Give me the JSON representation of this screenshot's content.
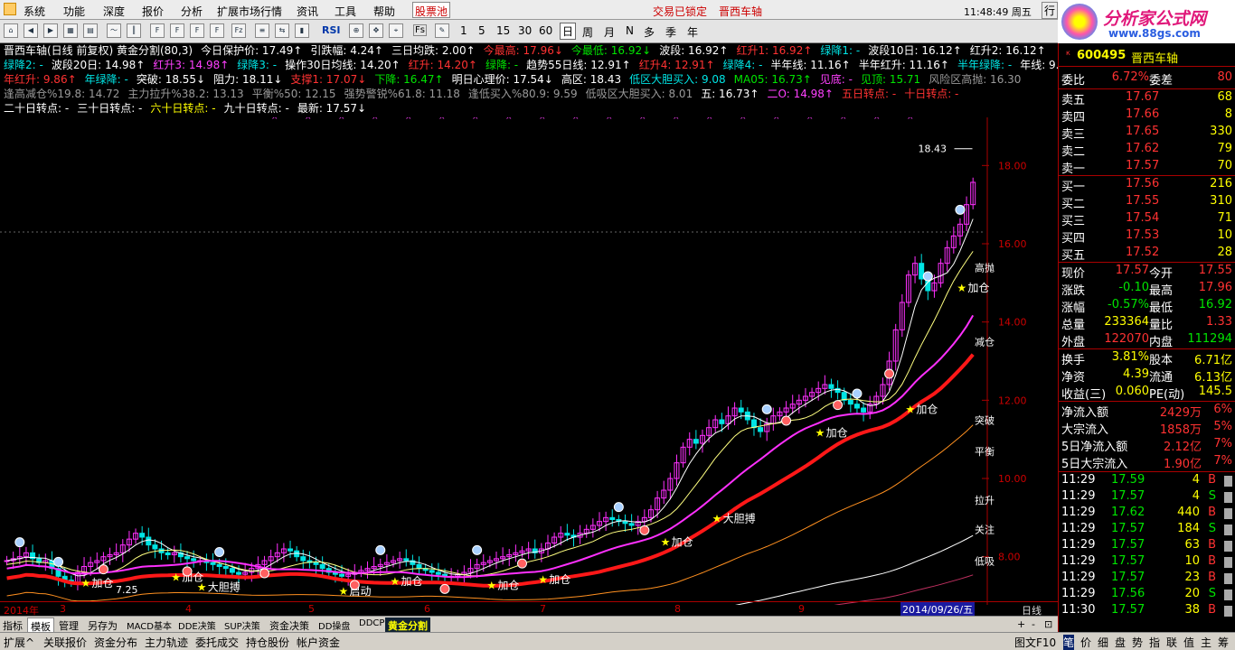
{
  "menu": {
    "items": [
      "系统",
      "功能",
      "深度",
      "报价",
      "分析",
      "扩展市场行情",
      "资讯",
      "工具",
      "帮助"
    ],
    "selected": "股票池",
    "status1": "交易已锁定",
    "stock_name": "晋西车轴",
    "clock": "11:48:49 周五",
    "right_stub": "行"
  },
  "logo": {
    "title": "分析家公式网",
    "url": "www.88gs.com"
  },
  "toolbar": {
    "periods": [
      "1",
      "5",
      "15",
      "30",
      "60",
      "日",
      "周",
      "月",
      "N",
      "多",
      "季",
      "年"
    ],
    "icon_labels": [
      "RSI",
      "Fs",
      "Fs"
    ]
  },
  "chart_info": {
    "line1": [
      {
        "t": "晋西车轴(日线 前复权) 黄金分割(80,3)",
        "c": "wht"
      },
      {
        "t": "今日保护价: 17.49↑",
        "c": "wht"
      },
      {
        "t": "引跌幅: 4.24↑",
        "c": "wht"
      },
      {
        "t": "三日均跌: 2.00↑",
        "c": "wht"
      },
      {
        "t": "今最高: 17.96↓",
        "c": "red"
      },
      {
        "t": "今最低: 16.92↓",
        "c": "grn"
      },
      {
        "t": "波段: 16.92↑",
        "c": "wht"
      },
      {
        "t": "红升1: 16.92↑",
        "c": "red"
      },
      {
        "t": "绿降1: -",
        "c": "cyan"
      },
      {
        "t": "波段10日: 16.12↑",
        "c": "wht"
      },
      {
        "t": "红升2: 16.12↑",
        "c": "wht"
      }
    ],
    "line2": [
      {
        "t": "绿降2: -",
        "c": "cyan"
      },
      {
        "t": "波段20日: 14.98↑",
        "c": "wht"
      },
      {
        "t": "红升3: 14.98↑",
        "c": "mag"
      },
      {
        "t": "绿降3: -",
        "c": "cyan"
      },
      {
        "t": "操作30日均线: 14.20↑",
        "c": "wht"
      },
      {
        "t": "红升: 14.20↑",
        "c": "red"
      },
      {
        "t": "绿降: -",
        "c": "grn"
      },
      {
        "t": "趋势55日线: 12.91↑",
        "c": "wht"
      },
      {
        "t": "红升4: 12.91↑",
        "c": "red"
      },
      {
        "t": "绿降4: -",
        "c": "cyan"
      },
      {
        "t": "半年线: 11.16↑",
        "c": "wht"
      },
      {
        "t": "半年红升: 11.16↑",
        "c": "wht"
      },
      {
        "t": "半年绿降: -",
        "c": "cyan"
      },
      {
        "t": "年线: 9.86",
        "c": "wht"
      }
    ],
    "line3": [
      {
        "t": "年红升: 9.86↑",
        "c": "red"
      },
      {
        "t": "年绿降: -",
        "c": "cyan"
      },
      {
        "t": "突破: 18.55↓",
        "c": "wht"
      },
      {
        "t": "阻力: 18.11↓",
        "c": "wht"
      },
      {
        "t": "支撑1: 17.07↓",
        "c": "red"
      },
      {
        "t": "下降: 16.47↑",
        "c": "grn"
      },
      {
        "t": "明日心理价: 17.54↓",
        "c": "wht"
      },
      {
        "t": "高区: 18.43",
        "c": "wht"
      },
      {
        "t": "低区大胆买入: 9.08",
        "c": "cyan"
      },
      {
        "t": "MA05: 16.73↑",
        "c": "grn"
      },
      {
        "t": "见底: -",
        "c": "mag"
      },
      {
        "t": "见顶: 15.71",
        "c": "grn"
      },
      {
        "t": "风险区高抛: 16.30",
        "c": "gry"
      }
    ],
    "line4": [
      {
        "t": "逢高减仓%19.8: 14.72",
        "c": "gry"
      },
      {
        "t": "主力拉升%38.2: 13.13",
        "c": "gry"
      },
      {
        "t": "平衡%50: 12.15",
        "c": "gry"
      },
      {
        "t": "强势警锐%61.8: 11.18",
        "c": "gry"
      },
      {
        "t": "逢低买入%80.9: 9.59",
        "c": "gry"
      },
      {
        "t": "低吸区大胆买入: 8.01",
        "c": "gry"
      },
      {
        "t": "五: 16.73↑",
        "c": "wht"
      },
      {
        "t": "二O: 14.98↑",
        "c": "mag"
      },
      {
        "t": "五日转点: -",
        "c": "red"
      },
      {
        "t": "十日转点: -",
        "c": "red"
      }
    ],
    "line5": [
      {
        "t": "二十日转点: -",
        "c": "wht"
      },
      {
        "t": "三十日转点: -",
        "c": "wht"
      },
      {
        "t": "六十日转点: -",
        "c": "yel"
      },
      {
        "t": "九十日转点: -",
        "c": "wht"
      },
      {
        "t": "最新: 17.57↓",
        "c": "wht"
      }
    ]
  },
  "chart_data": {
    "type": "candlestick",
    "title": "晋西车轴(日线 前复权) 黄金分割(80,3)",
    "y_ticks": [
      "18.00",
      "16.00",
      "14.00",
      "12.00",
      "10.00",
      "8.00"
    ],
    "ylim": [
      7.0,
      19.0
    ],
    "x_labels": [
      "2014年",
      "3",
      "4",
      "5",
      "6",
      "7",
      "8",
      "9"
    ],
    "date_badge": "2014/09/26/五",
    "period_label": "日线",
    "high_label": "18.43",
    "level_labels": [
      "高抛",
      "减仓",
      "突破",
      "平衡",
      "拉升",
      "关注",
      "低吸"
    ],
    "annotations": [
      "加仓",
      "大胆搏",
      "加仓",
      "启动",
      "加仓",
      "加仓",
      "加仓",
      "加仓",
      "大胆搏",
      "加仓",
      "加仓",
      "加仓",
      "7.25"
    ],
    "closes": [
      7.9,
      7.95,
      8.0,
      8.1,
      7.95,
      7.85,
      7.9,
      7.7,
      7.5,
      7.4,
      7.35,
      7.6,
      7.75,
      7.85,
      7.9,
      8.0,
      8.05,
      8.1,
      8.3,
      8.45,
      8.6,
      8.5,
      8.3,
      8.2,
      8.1,
      8.05,
      8.1,
      8.0,
      7.95,
      7.9,
      7.9,
      7.85,
      7.8,
      7.75,
      7.7,
      7.6,
      7.55,
      7.6,
      7.7,
      7.8,
      7.9,
      8.0,
      8.1,
      8.2,
      8.15,
      8.0,
      7.9,
      7.85,
      7.8,
      7.7,
      7.6,
      7.55,
      7.5,
      7.55,
      7.6,
      7.65,
      7.7,
      7.75,
      7.8,
      7.85,
      7.9,
      7.95,
      7.9,
      7.8,
      7.7,
      7.65,
      7.6,
      7.55,
      7.5,
      7.5,
      7.55,
      7.6,
      7.7,
      7.8,
      7.85,
      7.9,
      7.95,
      8.0,
      8.05,
      8.1,
      8.15,
      8.2,
      8.1,
      8.2,
      8.35,
      8.5,
      8.6,
      8.55,
      8.5,
      8.6,
      8.7,
      8.8,
      8.9,
      9.0,
      8.95,
      8.9,
      8.85,
      8.8,
      8.9,
      9.0,
      9.2,
      9.5,
      9.7,
      10.0,
      10.4,
      10.8,
      11.0,
      10.9,
      11.1,
      11.3,
      11.5,
      11.4,
      11.6,
      11.8,
      11.7,
      11.5,
      11.3,
      11.2,
      11.4,
      11.6,
      11.7,
      11.8,
      11.9,
      12.0,
      12.1,
      12.2,
      12.3,
      12.4,
      12.3,
      12.2,
      12.0,
      11.9,
      11.8,
      11.7,
      11.9,
      12.1,
      12.4,
      13.0,
      13.8,
      14.5,
      15.2,
      15.5,
      15.1,
      14.8,
      15.0,
      15.5,
      15.9,
      16.2,
      16.5,
      17.0,
      17.57
    ],
    "bull_market_start_index": 80,
    "ma_red_last": 14.2,
    "ma_magenta_last": 14.98,
    "ma_orange_last": 12.91,
    "ma_white_last": 11.16,
    "ma_year_last": 9.86
  },
  "panel": {
    "code": "600495",
    "name": "晋西车轴",
    "weibi": {
      "label": "委比",
      "val": "6.72%",
      "label2": "委差",
      "val2": "80"
    },
    "asks": [
      {
        "l": "卖五",
        "p": "17.67",
        "v": "68"
      },
      {
        "l": "卖四",
        "p": "17.66",
        "v": "8"
      },
      {
        "l": "卖三",
        "p": "17.65",
        "v": "330"
      },
      {
        "l": "卖二",
        "p": "17.62",
        "v": "79"
      },
      {
        "l": "卖一",
        "p": "17.57",
        "v": "70"
      }
    ],
    "bids": [
      {
        "l": "买一",
        "p": "17.56",
        "v": "216"
      },
      {
        "l": "买二",
        "p": "17.55",
        "v": "310"
      },
      {
        "l": "买三",
        "p": "17.54",
        "v": "71"
      },
      {
        "l": "买四",
        "p": "17.53",
        "v": "10"
      },
      {
        "l": "买五",
        "p": "17.52",
        "v": "28"
      }
    ],
    "quote": [
      {
        "l1": "现价",
        "v1": "17.57",
        "c1": "red",
        "l2": "今开",
        "v2": "17.55",
        "c2": "red"
      },
      {
        "l1": "涨跌",
        "v1": "-0.10",
        "c1": "grn",
        "l2": "最高",
        "v2": "17.96",
        "c2": "red"
      },
      {
        "l1": "涨幅",
        "v1": "-0.57%",
        "c1": "grn",
        "l2": "最低",
        "v2": "16.92",
        "c2": "grn"
      },
      {
        "l1": "总量",
        "v1": "233364",
        "c1": "yel",
        "l2": "量比",
        "v2": "1.33",
        "c2": "red"
      },
      {
        "l1": "外盘",
        "v1": "122070",
        "c1": "red",
        "l2": "内盘",
        "v2": "111294",
        "c2": "grn"
      }
    ],
    "fin": [
      {
        "l1": "换手",
        "v1": "3.81%",
        "l2": "股本",
        "v2": "6.71亿"
      },
      {
        "l1": "净资",
        "v1": "4.39",
        "l2": "流通",
        "v2": "6.13亿"
      },
      {
        "l1": "收益(三)",
        "v1": "0.060",
        "l2": "PE(动)",
        "v2": "145.5"
      }
    ],
    "flow": [
      {
        "l": "净流入额",
        "v": "2429万",
        "p": "6%"
      },
      {
        "l": "大宗流入",
        "v": "1858万",
        "p": "5%"
      },
      {
        "l": "5日净流入额",
        "v": "2.12亿",
        "p": "7%"
      },
      {
        "l": "5日大宗流入",
        "v": "1.90亿",
        "p": "7%"
      }
    ],
    "ticks": [
      {
        "t": "11:29",
        "p": "17.59",
        "v": "4",
        "s": "B"
      },
      {
        "t": "11:29",
        "p": "17.57",
        "v": "4",
        "s": "S"
      },
      {
        "t": "11:29",
        "p": "17.62",
        "v": "440",
        "s": "B"
      },
      {
        "t": "11:29",
        "p": "17.57",
        "v": "184",
        "s": "S"
      },
      {
        "t": "11:29",
        "p": "17.57",
        "v": "63",
        "s": "B"
      },
      {
        "t": "11:29",
        "p": "17.57",
        "v": "10",
        "s": "B"
      },
      {
        "t": "11:29",
        "p": "17.57",
        "v": "23",
        "s": "B"
      },
      {
        "t": "11:29",
        "p": "17.56",
        "v": "20",
        "s": "S"
      },
      {
        "t": "11:30",
        "p": "17.57",
        "v": "38",
        "s": "B"
      }
    ],
    "tabs": [
      "笔",
      "价",
      "细",
      "盘",
      "势",
      "指",
      "联",
      "值",
      "主",
      "筹"
    ]
  },
  "bottom_tabs": [
    "指标",
    "模板",
    "管理",
    "另存为",
    "MACD基本",
    "DDE决策",
    "SUP决策",
    "资金决策",
    "DD操盘",
    "DDCP",
    "黄金分割"
  ],
  "status_tabs": [
    "扩展^",
    "关联报价",
    "资金分布",
    "主力轨迹",
    "委托成交",
    "持仓股份",
    "帐户资金"
  ],
  "bottom_right": "图文F10",
  "scroll_btns": [
    "+",
    "-",
    "⊡"
  ]
}
